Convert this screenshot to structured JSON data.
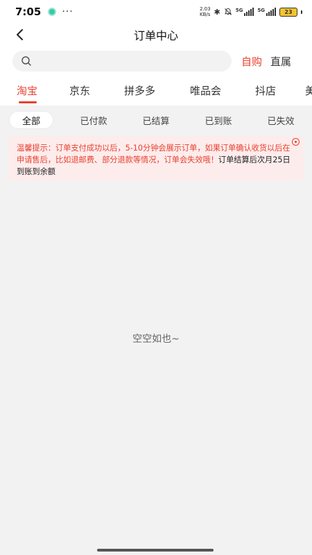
{
  "status_bar": {
    "time": "7:05",
    "more": "···",
    "net_speed_value": "2.03",
    "net_speed_unit": "KB/s",
    "bluetooth_glyph": "✱",
    "bell_off_glyph": "🔕",
    "sim1_label": "5G",
    "sim2_label": "5G",
    "battery_level": "23"
  },
  "header": {
    "title": "订单中心"
  },
  "search": {
    "value": "",
    "placeholder": ""
  },
  "mode_tabs": [
    {
      "label": "自购",
      "active": true
    },
    {
      "label": "直属",
      "active": false
    }
  ],
  "platform_tabs": [
    {
      "label": "淘宝",
      "active": true
    },
    {
      "label": "京东",
      "active": false
    },
    {
      "label": "拼多多",
      "active": false
    },
    {
      "label": "唯品会",
      "active": false
    },
    {
      "label": "抖店",
      "active": false
    },
    {
      "label": "美",
      "active": false
    }
  ],
  "filters": [
    {
      "label": "全部",
      "active": true
    },
    {
      "label": "已付款",
      "active": false
    },
    {
      "label": "已结算",
      "active": false
    },
    {
      "label": "已到账",
      "active": false
    },
    {
      "label": "已失效",
      "active": false
    }
  ],
  "notice": {
    "text": "温馨提示：订单支付成功以后，5-10分钟会展示订单，如果订单确认收货以后在申请售后，比如退邮费、部分退款等情况，订单会失效哦！",
    "emphasis": "订单结算后次月25日到账到余额"
  },
  "empty_state": {
    "text": "空空如也~"
  },
  "colors": {
    "accent": "#e8412e",
    "notice_bg": "#fdecec",
    "page_bg": "#f2f2f2"
  }
}
